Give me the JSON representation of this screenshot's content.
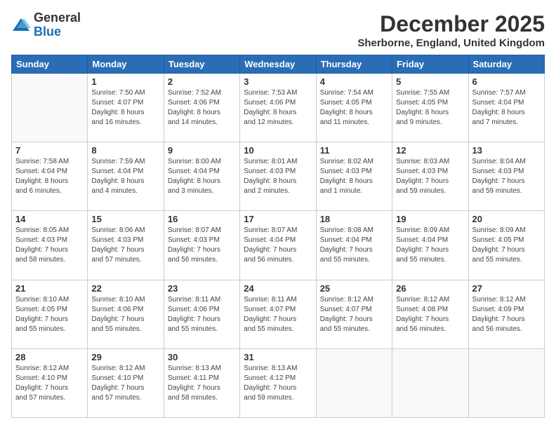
{
  "logo": {
    "general": "General",
    "blue": "Blue"
  },
  "header": {
    "month_year": "December 2025",
    "location": "Sherborne, England, United Kingdom"
  },
  "days_of_week": [
    "Sunday",
    "Monday",
    "Tuesday",
    "Wednesday",
    "Thursday",
    "Friday",
    "Saturday"
  ],
  "weeks": [
    [
      {
        "day": "",
        "info": ""
      },
      {
        "day": "1",
        "info": "Sunrise: 7:50 AM\nSunset: 4:07 PM\nDaylight: 8 hours\nand 16 minutes."
      },
      {
        "day": "2",
        "info": "Sunrise: 7:52 AM\nSunset: 4:06 PM\nDaylight: 8 hours\nand 14 minutes."
      },
      {
        "day": "3",
        "info": "Sunrise: 7:53 AM\nSunset: 4:06 PM\nDaylight: 8 hours\nand 12 minutes."
      },
      {
        "day": "4",
        "info": "Sunrise: 7:54 AM\nSunset: 4:05 PM\nDaylight: 8 hours\nand 11 minutes."
      },
      {
        "day": "5",
        "info": "Sunrise: 7:55 AM\nSunset: 4:05 PM\nDaylight: 8 hours\nand 9 minutes."
      },
      {
        "day": "6",
        "info": "Sunrise: 7:57 AM\nSunset: 4:04 PM\nDaylight: 8 hours\nand 7 minutes."
      }
    ],
    [
      {
        "day": "7",
        "info": "Sunrise: 7:58 AM\nSunset: 4:04 PM\nDaylight: 8 hours\nand 6 minutes."
      },
      {
        "day": "8",
        "info": "Sunrise: 7:59 AM\nSunset: 4:04 PM\nDaylight: 8 hours\nand 4 minutes."
      },
      {
        "day": "9",
        "info": "Sunrise: 8:00 AM\nSunset: 4:04 PM\nDaylight: 8 hours\nand 3 minutes."
      },
      {
        "day": "10",
        "info": "Sunrise: 8:01 AM\nSunset: 4:03 PM\nDaylight: 8 hours\nand 2 minutes."
      },
      {
        "day": "11",
        "info": "Sunrise: 8:02 AM\nSunset: 4:03 PM\nDaylight: 8 hours\nand 1 minute."
      },
      {
        "day": "12",
        "info": "Sunrise: 8:03 AM\nSunset: 4:03 PM\nDaylight: 7 hours\nand 59 minutes."
      },
      {
        "day": "13",
        "info": "Sunrise: 8:04 AM\nSunset: 4:03 PM\nDaylight: 7 hours\nand 59 minutes."
      }
    ],
    [
      {
        "day": "14",
        "info": "Sunrise: 8:05 AM\nSunset: 4:03 PM\nDaylight: 7 hours\nand 58 minutes."
      },
      {
        "day": "15",
        "info": "Sunrise: 8:06 AM\nSunset: 4:03 PM\nDaylight: 7 hours\nand 57 minutes."
      },
      {
        "day": "16",
        "info": "Sunrise: 8:07 AM\nSunset: 4:03 PM\nDaylight: 7 hours\nand 56 minutes."
      },
      {
        "day": "17",
        "info": "Sunrise: 8:07 AM\nSunset: 4:04 PM\nDaylight: 7 hours\nand 56 minutes."
      },
      {
        "day": "18",
        "info": "Sunrise: 8:08 AM\nSunset: 4:04 PM\nDaylight: 7 hours\nand 55 minutes."
      },
      {
        "day": "19",
        "info": "Sunrise: 8:09 AM\nSunset: 4:04 PM\nDaylight: 7 hours\nand 55 minutes."
      },
      {
        "day": "20",
        "info": "Sunrise: 8:09 AM\nSunset: 4:05 PM\nDaylight: 7 hours\nand 55 minutes."
      }
    ],
    [
      {
        "day": "21",
        "info": "Sunrise: 8:10 AM\nSunset: 4:05 PM\nDaylight: 7 hours\nand 55 minutes."
      },
      {
        "day": "22",
        "info": "Sunrise: 8:10 AM\nSunset: 4:06 PM\nDaylight: 7 hours\nand 55 minutes."
      },
      {
        "day": "23",
        "info": "Sunrise: 8:11 AM\nSunset: 4:06 PM\nDaylight: 7 hours\nand 55 minutes."
      },
      {
        "day": "24",
        "info": "Sunrise: 8:11 AM\nSunset: 4:07 PM\nDaylight: 7 hours\nand 55 minutes."
      },
      {
        "day": "25",
        "info": "Sunrise: 8:12 AM\nSunset: 4:07 PM\nDaylight: 7 hours\nand 55 minutes."
      },
      {
        "day": "26",
        "info": "Sunrise: 8:12 AM\nSunset: 4:08 PM\nDaylight: 7 hours\nand 56 minutes."
      },
      {
        "day": "27",
        "info": "Sunrise: 8:12 AM\nSunset: 4:09 PM\nDaylight: 7 hours\nand 56 minutes."
      }
    ],
    [
      {
        "day": "28",
        "info": "Sunrise: 8:12 AM\nSunset: 4:10 PM\nDaylight: 7 hours\nand 57 minutes."
      },
      {
        "day": "29",
        "info": "Sunrise: 8:12 AM\nSunset: 4:10 PM\nDaylight: 7 hours\nand 57 minutes."
      },
      {
        "day": "30",
        "info": "Sunrise: 8:13 AM\nSunset: 4:11 PM\nDaylight: 7 hours\nand 58 minutes."
      },
      {
        "day": "31",
        "info": "Sunrise: 8:13 AM\nSunset: 4:12 PM\nDaylight: 7 hours\nand 59 minutes."
      },
      {
        "day": "",
        "info": ""
      },
      {
        "day": "",
        "info": ""
      },
      {
        "day": "",
        "info": ""
      }
    ]
  ]
}
